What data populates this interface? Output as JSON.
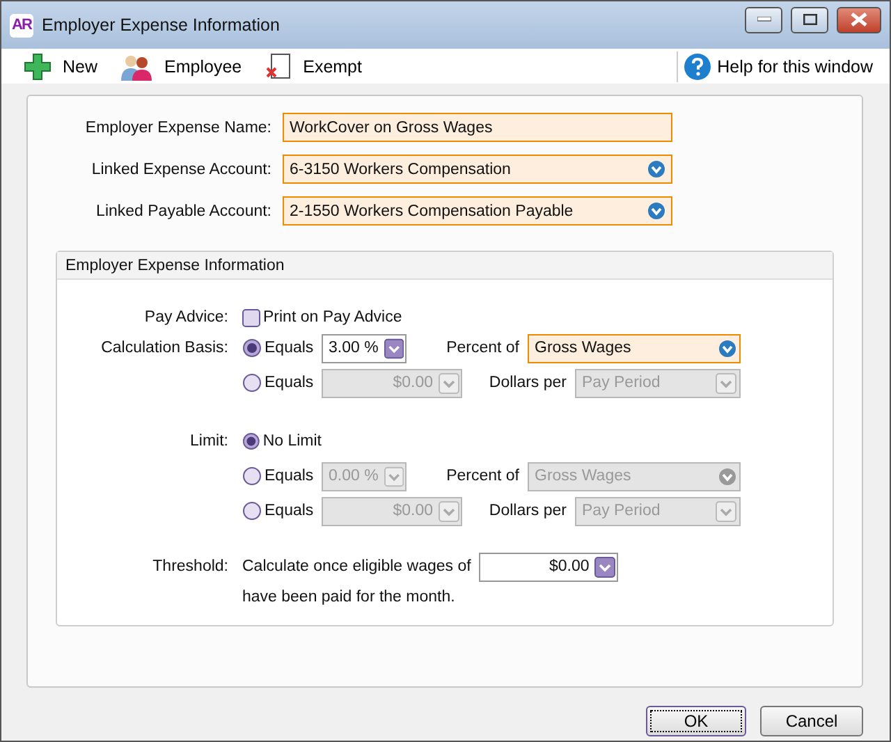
{
  "window": {
    "logo": "AR",
    "title": "Employer Expense Information"
  },
  "toolbar": [
    {
      "label": "New",
      "kind": "new"
    },
    {
      "label": "Employee",
      "kind": "employee"
    },
    {
      "label": "Exempt",
      "kind": "exempt"
    }
  ],
  "help": "Help for this window",
  "fields": [
    {
      "label": "Employer Expense Name:",
      "value": "WorkCover on Gross Wages",
      "kind": "text"
    },
    {
      "label": "Linked Expense Account:",
      "value": "6-3150 Workers Compensation",
      "kind": "dropdown"
    },
    {
      "label": "Linked Payable Account:",
      "value": "2-1550 Workers Compensation Payable",
      "kind": "dropdown"
    }
  ],
  "section": {
    "title": "Employer Expense Information",
    "pay_advice": {
      "label": "Pay Advice:",
      "checkbox_label": "Print on Pay Advice",
      "checked": false
    },
    "calculation_basis": {
      "label": "Calculation Basis:",
      "options": [
        {
          "label": "Equals",
          "selected": true,
          "kind": "percent",
          "amount": "3.00 %",
          "unit_label": "Percent of",
          "unit": "Gross Wages"
        },
        {
          "label": "Equals",
          "selected": false,
          "kind": "dollars",
          "amount": "$0.00",
          "unit_label": "Dollars per",
          "unit": "Pay Period"
        }
      ]
    },
    "limit": {
      "label": "Limit:",
      "options": [
        {
          "label": "No Limit",
          "selected": true,
          "kind": "none"
        },
        {
          "label": "Equals",
          "selected": false,
          "kind": "percent",
          "amount": "0.00 %",
          "unit_label": "Percent of",
          "unit": "Gross Wages"
        },
        {
          "label": "Equals",
          "selected": false,
          "kind": "dollars",
          "amount": "$0.00",
          "unit_label": "Dollars per",
          "unit": "Pay Period"
        }
      ]
    },
    "threshold": {
      "label": "Threshold:",
      "text_before": "Calculate once eligible wages of",
      "amount": "$0.00",
      "text_after": "have been paid for the month."
    }
  },
  "buttons": [
    {
      "label": "OK",
      "focused": true
    },
    {
      "label": "Cancel",
      "focused": false
    }
  ]
}
